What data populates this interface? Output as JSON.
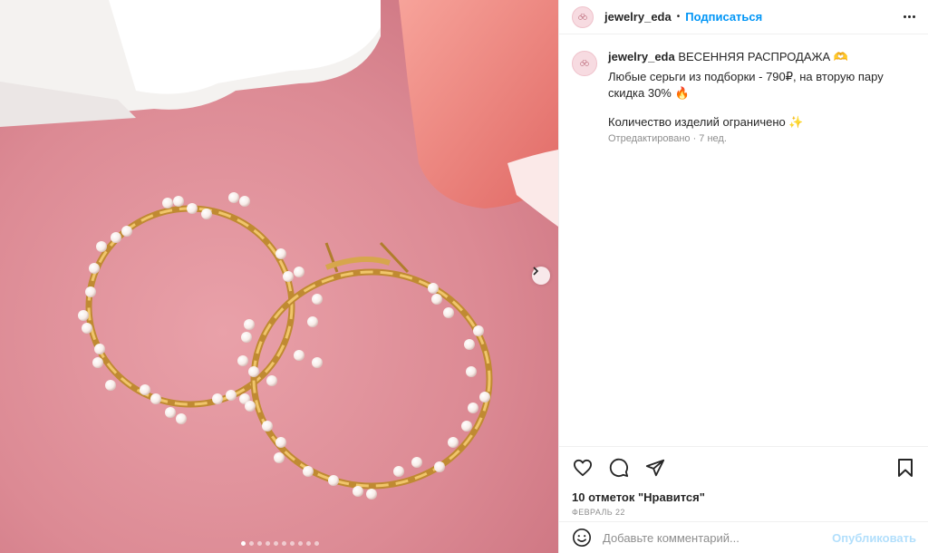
{
  "photo": {
    "alt_icon": "pearl-hoop-earrings-photo",
    "carousel_dot_count": 10,
    "carousel_active_index": 0
  },
  "header": {
    "username": "jewelry_eda",
    "separator": "•",
    "follow_label": "Подписаться"
  },
  "caption": {
    "username": "jewelry_eda",
    "line1": "ВЕСЕННЯЯ РАСПРОДАЖА 🫶",
    "line2": "Любые серьги из подборки - 790₽, на вторую пару скидка 30% 🔥",
    "line3": "Количество изделий ограничено ✨",
    "edited": "Отредактировано · 7 нед."
  },
  "actions": {
    "likes": "10 отметок \"Нравится\"",
    "date": "ФЕВРАЛЬ 22"
  },
  "comment": {
    "placeholder": "Добавьте комментарий...",
    "publish_label": "Опубликовать"
  },
  "colors": {
    "accent": "#0095f6",
    "publish_disabled": "#b2dffc",
    "muted": "#8e8e8e",
    "photo_bg": "#dc8a94"
  }
}
